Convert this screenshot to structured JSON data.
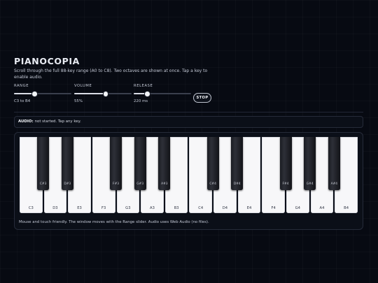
{
  "app": {
    "title": "PIANOCOPIA",
    "subtitle": "Scroll through the full 88-key range (A0 to C8). Two octaves are shown at once. Tap a key to enable audio."
  },
  "controls": {
    "range": {
      "label": "RANGE",
      "value_text": "C3 to B4",
      "level": 0.36
    },
    "volume": {
      "label": "VOLUME",
      "value_text": "55%",
      "level": 0.55
    },
    "release": {
      "label": "RELEASE",
      "value_text": "220 ms",
      "level": 0.24
    },
    "stop_label": "STOP"
  },
  "audio": {
    "label": "AUDIO:",
    "status": "not started. Tap any key."
  },
  "piano": {
    "white_keys": [
      "C3",
      "D3",
      "E3",
      "F3",
      "G3",
      "A3",
      "B3",
      "C4",
      "D4",
      "E4",
      "F4",
      "G4",
      "A4",
      "B4"
    ],
    "black_keys": [
      {
        "label": "C#3",
        "after_white": 0
      },
      {
        "label": "D#3",
        "after_white": 1
      },
      {
        "label": "F#3",
        "after_white": 3
      },
      {
        "label": "G#3",
        "after_white": 4
      },
      {
        "label": "A#3",
        "after_white": 5
      },
      {
        "label": "C#4",
        "after_white": 7
      },
      {
        "label": "D#4",
        "after_white": 8
      },
      {
        "label": "F#4",
        "after_white": 10
      },
      {
        "label": "G#4",
        "after_white": 11
      },
      {
        "label": "A#4",
        "after_white": 12
      }
    ]
  },
  "footnote": "Mouse and touch friendly. The window moves with the Range slider. Audio uses Web Audio (no files)."
}
